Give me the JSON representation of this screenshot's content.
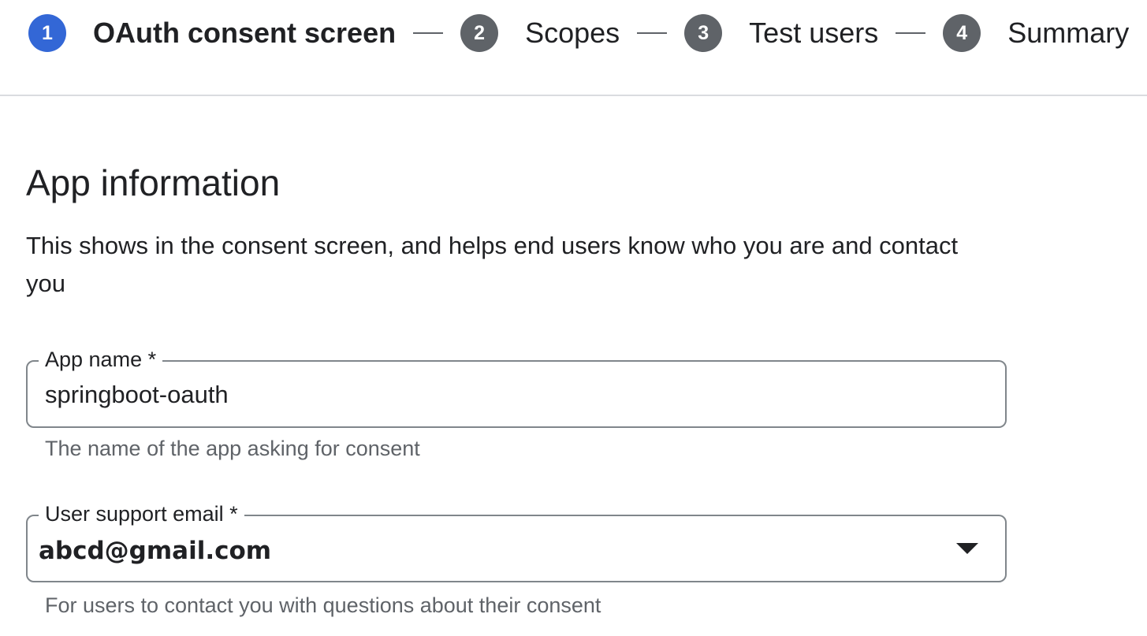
{
  "stepper": {
    "steps": [
      {
        "number": "1",
        "label": "OAuth consent screen"
      },
      {
        "number": "2",
        "label": "Scopes"
      },
      {
        "number": "3",
        "label": "Test users"
      },
      {
        "number": "4",
        "label": "Summary"
      }
    ],
    "active_step": "1"
  },
  "section": {
    "title": "App information",
    "description": "This shows in the consent screen, and helps end users know who you are and contact you"
  },
  "fields": {
    "app_name": {
      "label": "App name *",
      "value": "springboot-oauth",
      "helper": "The name of the app asking for consent"
    },
    "support_email": {
      "label": "User support email *",
      "value": "abcd@gmail.com",
      "helper": "For users to contact you with questions about their consent"
    }
  },
  "icons": {
    "dropdown": "chevron-down-icon"
  },
  "colors": {
    "active_step": "#3367d6",
    "inactive_step": "#5f6368",
    "border": "#80868b",
    "divider": "#dadce0",
    "helper_text": "#5f6368"
  }
}
